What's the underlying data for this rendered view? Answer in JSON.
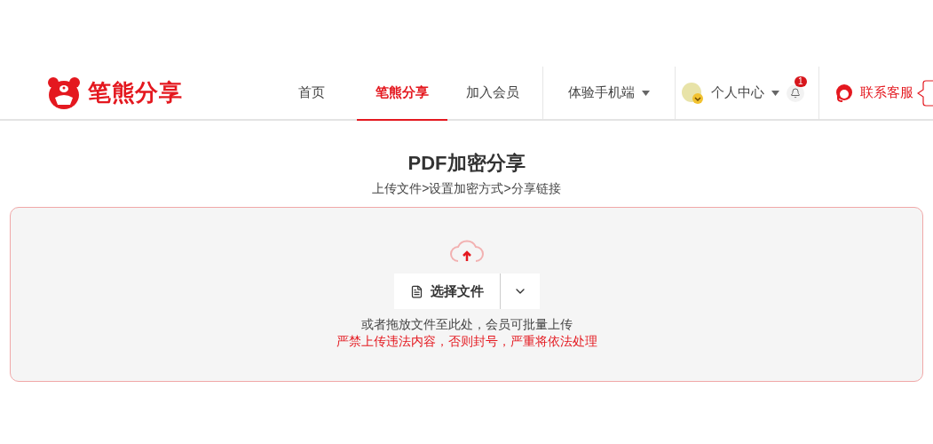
{
  "logo": {
    "text": "笔熊分享"
  },
  "nav": [
    {
      "label": "首页",
      "selected": false
    },
    {
      "label": "笔熊分享",
      "selected": true
    },
    {
      "label": "加入会员",
      "selected": false
    }
  ],
  "mobile_menu": {
    "label": "体验手机端"
  },
  "user_menu": {
    "label": "个人中心",
    "notification_count": "1"
  },
  "support": {
    "label": "联系客服"
  },
  "page": {
    "title": "PDF加密分享",
    "steps": "上传文件>设置加密方式>分享链接"
  },
  "upload": {
    "button": "选择文件",
    "hint": "或者拖放文件至此处，会员可批量上传",
    "warning": "严禁上传违法内容，否则封号，严重将依法处理"
  }
}
